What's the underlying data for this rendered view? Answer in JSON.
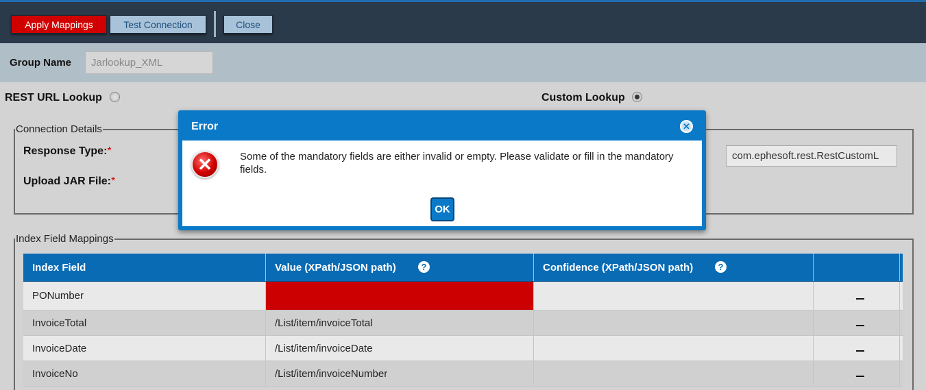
{
  "toolbar": {
    "apply_label": "Apply Mappings",
    "test_label": "Test Connection",
    "close_label": "Close"
  },
  "group": {
    "label": "Group Name",
    "value": "Jarlookup_XML"
  },
  "lookup_options": {
    "rest_label": "REST URL Lookup",
    "rest_selected": false,
    "custom_label": "Custom Lookup",
    "custom_selected": true
  },
  "connection": {
    "legend": "Connection Details",
    "response_type_label": "Response Type:",
    "upload_jar_label": "Upload JAR File:",
    "required_marker": "*",
    "class_name_value": "com.ephesoft.rest.RestCustomL"
  },
  "mappings": {
    "legend": "Index Field Mappings",
    "columns": [
      "Index Field",
      "Value (XPath/JSON path)",
      "Confidence (XPath/JSON path)",
      ""
    ],
    "help_glyph": "?",
    "remove_glyph": "minus-icon",
    "rows": [
      {
        "index_field": "PONumber",
        "value": "",
        "confidence": "",
        "invalid": true
      },
      {
        "index_field": "InvoiceTotal",
        "value": "/List/item/invoiceTotal",
        "confidence": "",
        "invalid": false
      },
      {
        "index_field": "InvoiceDate",
        "value": "/List/item/invoiceDate",
        "confidence": "",
        "invalid": false
      },
      {
        "index_field": "InvoiceNo",
        "value": "/List/item/invoiceNumber",
        "confidence": "",
        "invalid": false
      }
    ]
  },
  "dialog": {
    "title": "Error",
    "message": "Some of the mandatory fields are either invalid or empty. Please validate or fill in the mandatory fields.",
    "ok_label": "OK",
    "icon": "error-icon"
  },
  "colors": {
    "toolbar_bg": "#2b3a4b",
    "apply_button": "#d10000",
    "dialog_blue": "#0a7ac8",
    "table_header": "#0a6bb5",
    "invalid_cell": "#cc0000"
  }
}
